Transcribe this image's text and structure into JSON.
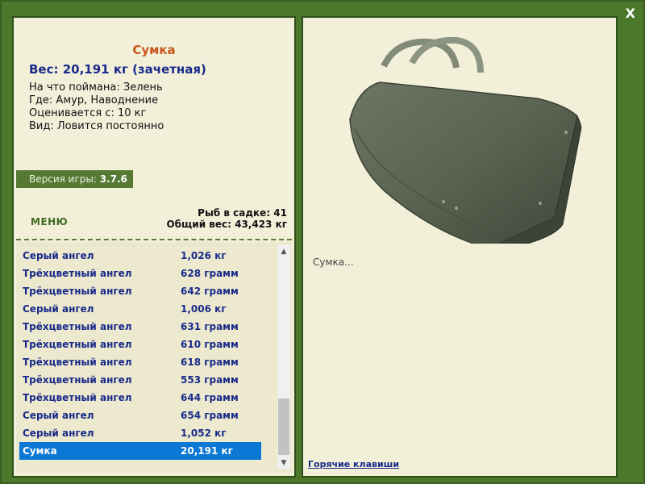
{
  "window": {
    "close_label": "X"
  },
  "fish": {
    "title": "Сумка",
    "weight": "Вес: 20,191 кг (зачетная)",
    "details": [
      "На что поймана: Зелень",
      "Где: Амур, Наводнение",
      "Оценивается с: 10 кг",
      "Вид: Ловится постоянно"
    ]
  },
  "version": {
    "label": "Версия игры:",
    "value": "3.7.6"
  },
  "menu": {
    "label": "МЕНЮ"
  },
  "stats": {
    "fish_count": "Рыб в садке: 41",
    "total_weight": "Общий вес: 43,423 кг"
  },
  "catch_list": {
    "rows": [
      {
        "name": "Серый ангел",
        "weight": "1,026 кг",
        "selected": false
      },
      {
        "name": "Трёхцветный ангел",
        "weight": "628 грамм",
        "selected": false
      },
      {
        "name": "Трёхцветный ангел",
        "weight": "642 грамм",
        "selected": false
      },
      {
        "name": "Серый ангел",
        "weight": "1,006 кг",
        "selected": false
      },
      {
        "name": "Трёхцветный ангел",
        "weight": "631 грамм",
        "selected": false
      },
      {
        "name": "Трёхцветный ангел",
        "weight": "610 грамм",
        "selected": false
      },
      {
        "name": "Трёхцветный ангел",
        "weight": "618 грамм",
        "selected": false
      },
      {
        "name": "Трёхцветный ангел",
        "weight": "553 грамм",
        "selected": false
      },
      {
        "name": "Трёхцветный ангел",
        "weight": "644 грамм",
        "selected": false
      },
      {
        "name": "Серый ангел",
        "weight": "654 грамм",
        "selected": false
      },
      {
        "name": "Серый ангел",
        "weight": "1,052 кг",
        "selected": false
      },
      {
        "name": "Сумка",
        "weight": "20,191 кг",
        "selected": true
      }
    ]
  },
  "detail_panel": {
    "description": "Сумка...",
    "hotkeys_label": "Горячие клавиши"
  },
  "colors": {
    "frame": "#4c782c",
    "panel": "#f3f0da",
    "title": "#c8541a",
    "text_blue": "#1a2a8a",
    "selection": "#0a78d4"
  }
}
